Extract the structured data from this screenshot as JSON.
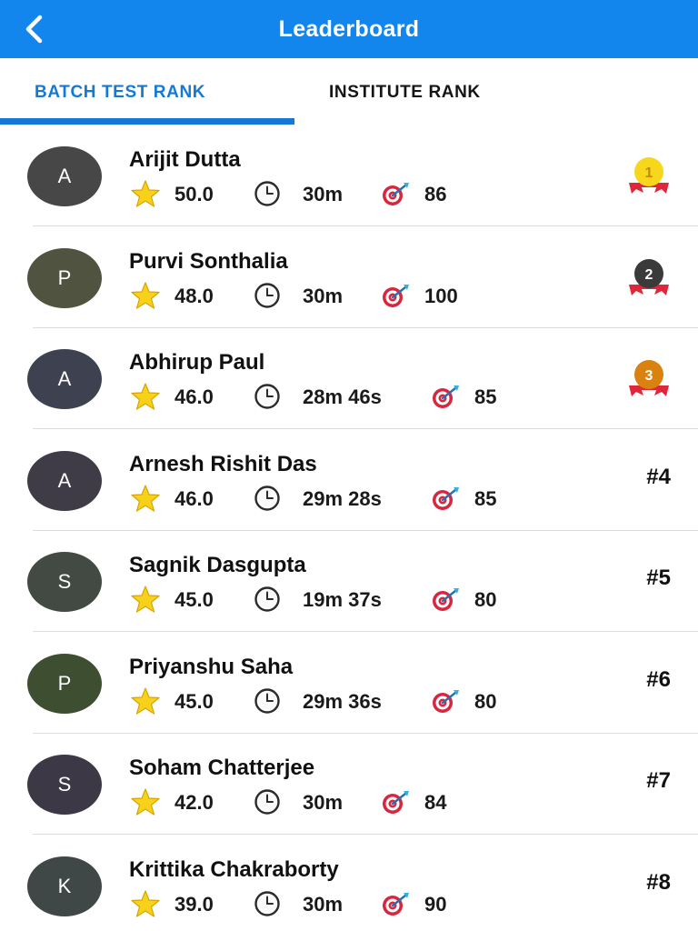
{
  "header": {
    "title": "Leaderboard",
    "back_icon": "chevron-left-icon"
  },
  "tabs": [
    {
      "label": "BATCH TEST RANK",
      "active": true
    },
    {
      "label": "INSTITUTE RANK",
      "active": false
    }
  ],
  "colors": {
    "primary": "#1386ee",
    "active_tab": "#1479d6",
    "gold": "#f7d71c",
    "silver": "#3a3a3a",
    "bronze": "#d98210",
    "ribbon": "#e0263a"
  },
  "entries": [
    {
      "initial": "A",
      "name": "Arijit Dutta",
      "score": "50.0",
      "time": "30m",
      "accuracy": "86",
      "rank": "1",
      "medal": "gold",
      "avatar_color": "#474747"
    },
    {
      "initial": "P",
      "name": "Purvi Sonthalia",
      "score": "48.0",
      "time": "30m",
      "accuracy": "100",
      "rank": "2",
      "medal": "silver",
      "avatar_color": "#4f5340"
    },
    {
      "initial": "A",
      "name": "Abhirup Paul",
      "score": "46.0",
      "time": "28m 46s",
      "accuracy": "85",
      "rank": "3",
      "medal": "bronze",
      "avatar_color": "#3e4150"
    },
    {
      "initial": "A",
      "name": "Arnesh Rishit Das",
      "score": "46.0",
      "time": "29m 28s",
      "accuracy": "85",
      "rank": "#4",
      "medal": null,
      "avatar_color": "#3f3b47"
    },
    {
      "initial": "S",
      "name": "Sagnik Dasgupta",
      "score": "45.0",
      "time": "19m 37s",
      "accuracy": "80",
      "rank": "#5",
      "medal": null,
      "avatar_color": "#434a43"
    },
    {
      "initial": "P",
      "name": "Priyanshu Saha",
      "score": "45.0",
      "time": "29m 36s",
      "accuracy": "80",
      "rank": "#6",
      "medal": null,
      "avatar_color": "#3d4e31"
    },
    {
      "initial": "S",
      "name": "Soham Chatterjee",
      "score": "42.0",
      "time": "30m",
      "accuracy": "84",
      "rank": "#7",
      "medal": null,
      "avatar_color": "#3c3845"
    },
    {
      "initial": "K",
      "name": "Krittika Chakraborty",
      "score": "39.0",
      "time": "30m",
      "accuracy": "90",
      "rank": "#8",
      "medal": null,
      "avatar_color": "#3f4847"
    }
  ]
}
